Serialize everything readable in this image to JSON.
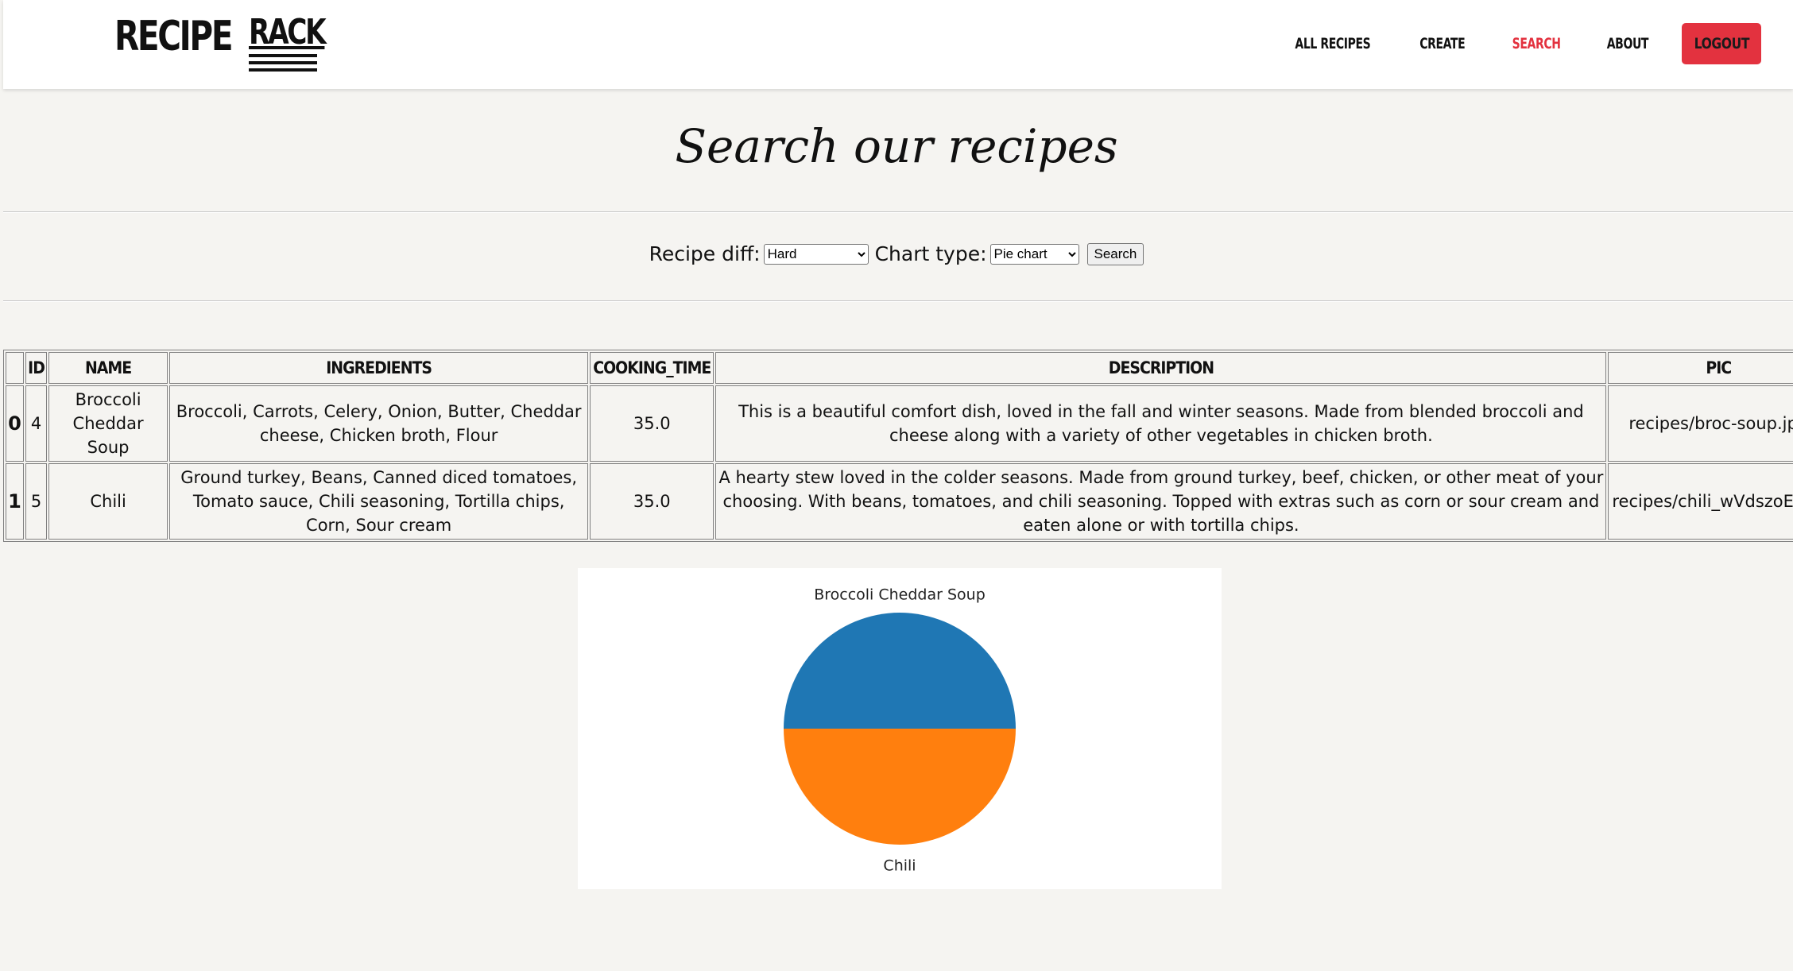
{
  "brand": {
    "word1": "RECIPE",
    "word2": "RACK"
  },
  "nav": {
    "items": [
      {
        "label": "ALL RECIPES",
        "active": false
      },
      {
        "label": "CREATE",
        "active": false
      },
      {
        "label": "SEARCH",
        "active": true
      },
      {
        "label": "ABOUT",
        "active": false
      }
    ],
    "logout_label": "LOGOUT",
    "accent_color": "#e3323f"
  },
  "page": {
    "title": "Search our recipes"
  },
  "search_form": {
    "diff_label": "Recipe diff:",
    "diff_selected": "Hard",
    "chart_label": "Chart type:",
    "chart_selected": "Pie chart",
    "submit_label": "Search"
  },
  "results_table": {
    "columns": [
      "",
      "ID",
      "NAME",
      "INGREDIENTS",
      "COOKING_TIME",
      "DESCRIPTION",
      "PIC"
    ],
    "rows": [
      {
        "index": "0",
        "id": "4",
        "name": "Broccoli Cheddar Soup",
        "ingredients": "Broccoli, Carrots, Celery, Onion, Butter, Cheddar cheese, Chicken broth, Flour",
        "cooking_time": "35.0",
        "description": "This is a beautiful comfort dish, loved in the fall and winter seasons. Made from blended broccoli and cheese along with a variety of other vegetables in chicken broth.",
        "pic": "recipes/broc-soup.jpg"
      },
      {
        "index": "1",
        "id": "5",
        "name": "Chili",
        "ingredients": "Ground turkey, Beans, Canned diced tomatoes, Tomato sauce, Chili seasoning, Tortilla chips, Corn, Sour cream",
        "cooking_time": "35.0",
        "description": "A hearty stew loved in the colder seasons. Made from ground turkey, beef, chicken, or other meat of your choosing. With beans, tomatoes, and chili seasoning. Topped with extras such as corn or sour cream and eaten alone or with tortilla chips.",
        "pic": "recipes/chili_wVdszoE.jpg"
      }
    ]
  },
  "chart_data": {
    "type": "pie",
    "labels": [
      "Broccoli Cheddar Soup",
      "Chili"
    ],
    "values": [
      35.0,
      35.0
    ],
    "colors": [
      "#1f77b4",
      "#ff7f0e"
    ],
    "legend": "none",
    "label_placement": "outside"
  }
}
